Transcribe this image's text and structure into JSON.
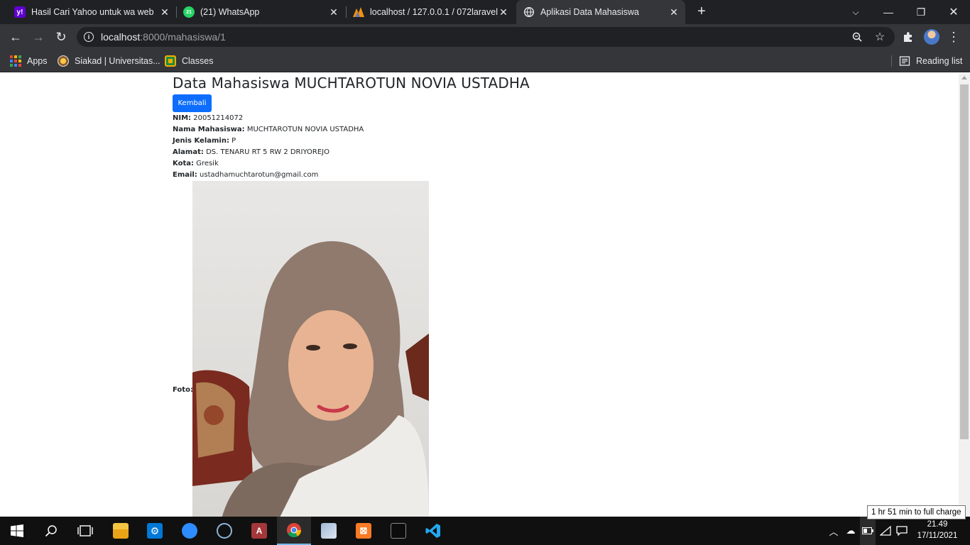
{
  "browser": {
    "tabs": [
      {
        "title": "Hasil Cari Yahoo untuk wa web",
        "icon": "yahoo-icon"
      },
      {
        "title": "(21) WhatsApp",
        "icon": "whatsapp-icon"
      },
      {
        "title": "localhost / 127.0.0.1 / 072laravel_",
        "icon": "phpmyadmin-icon"
      },
      {
        "title": "Aplikasi Data Mahasiswa",
        "icon": "globe-icon",
        "active": true
      }
    ],
    "address": {
      "host": "localhost",
      "rest": ":8000/mahasiswa/1"
    },
    "bookmarks": [
      {
        "label": "Apps",
        "icon": "apps-grid-icon"
      },
      {
        "label": "Siakad | Universitas...",
        "icon": "university-icon"
      },
      {
        "label": "Classes",
        "icon": "google-classroom-icon"
      }
    ],
    "reading_list": "Reading list"
  },
  "page": {
    "title": "Data Mahasiswa MUCHTAROTUN NOVIA USTADHA",
    "back_button": "Kembali",
    "fields": [
      {
        "label": "NIM:",
        "value": "20051214072"
      },
      {
        "label": "Nama Mahasiswa:",
        "value": "MUCHTAROTUN NOVIA USTADHA"
      },
      {
        "label": "Jenis Kelamin:",
        "value": "P"
      },
      {
        "label": "Alamat:",
        "value": "DS. TENARU RT 5 RW 2 DRIYOREJO"
      },
      {
        "label": "Kota:",
        "value": "Gresik"
      },
      {
        "label": "Email:",
        "value": "ustadhamuchtarotun@gmail.com"
      }
    ],
    "photo_label": "Foto:"
  },
  "taskbar": {
    "time": "21.49",
    "date": "17/11/2021",
    "battery_tooltip": "1 hr 51 min to full charge"
  },
  "colors": {
    "primary_button": "#0d6efd",
    "chrome_dark": "#202124",
    "chrome_toolbar": "#35363a"
  }
}
